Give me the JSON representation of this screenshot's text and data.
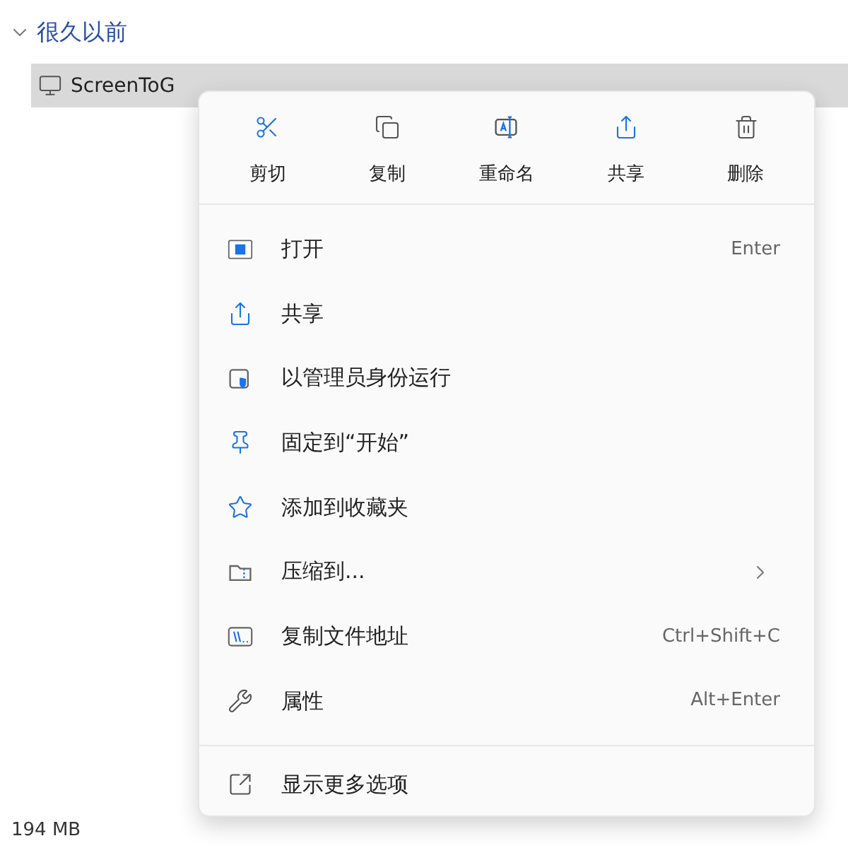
{
  "group": {
    "title": "很久以前",
    "expanded": true
  },
  "file_row": {
    "name": "ScreenToG",
    "selected": true
  },
  "context_menu": {
    "actions": [
      {
        "kind": "cut",
        "label": "剪切"
      },
      {
        "kind": "copy",
        "label": "复制"
      },
      {
        "kind": "rename",
        "label": "重命名"
      },
      {
        "kind": "share",
        "label": "共享"
      },
      {
        "kind": "delete",
        "label": "删除"
      }
    ],
    "items": [
      {
        "kind": "open",
        "label": "打开",
        "shortcut": "Enter"
      },
      {
        "kind": "share",
        "label": "共享"
      },
      {
        "kind": "admin",
        "label": "以管理员身份运行"
      },
      {
        "kind": "pin",
        "label": "固定到“开始”"
      },
      {
        "kind": "favorite",
        "label": "添加到收藏夹"
      },
      {
        "kind": "compress",
        "label": "压缩到...",
        "submenu": true
      },
      {
        "kind": "copypath",
        "label": "复制文件地址",
        "shortcut": "Ctrl+Shift+C"
      },
      {
        "kind": "properties",
        "label": "属性",
        "shortcut": "Alt+Enter"
      }
    ],
    "footer": {
      "kind": "more",
      "label": "显示更多选项"
    }
  },
  "status_bar": {
    "size": "194 MB"
  }
}
